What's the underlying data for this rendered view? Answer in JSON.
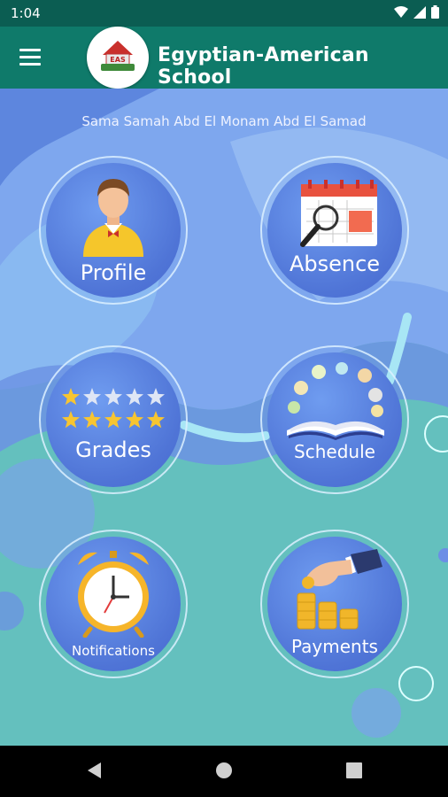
{
  "status_bar": {
    "time": "1:04"
  },
  "app_bar": {
    "title": "Egyptian-American School",
    "logo_text": "EAS"
  },
  "student": {
    "name": "Sama Samah Abd El Monam Abd El Samad"
  },
  "tiles": {
    "profile": {
      "label": "Profile"
    },
    "absence": {
      "label": "Absence"
    },
    "grades": {
      "label": "Grades"
    },
    "schedule": {
      "label": "Schedule"
    },
    "notifications": {
      "label": "Notifications"
    },
    "payments": {
      "label": "Payments"
    }
  },
  "colors": {
    "status_bar": "#0b5d52",
    "app_bar": "#0f7a6a",
    "tile_blue": "#4f74d6",
    "background_teal": "#64c0be",
    "background_blue": "#7fa6ee"
  }
}
